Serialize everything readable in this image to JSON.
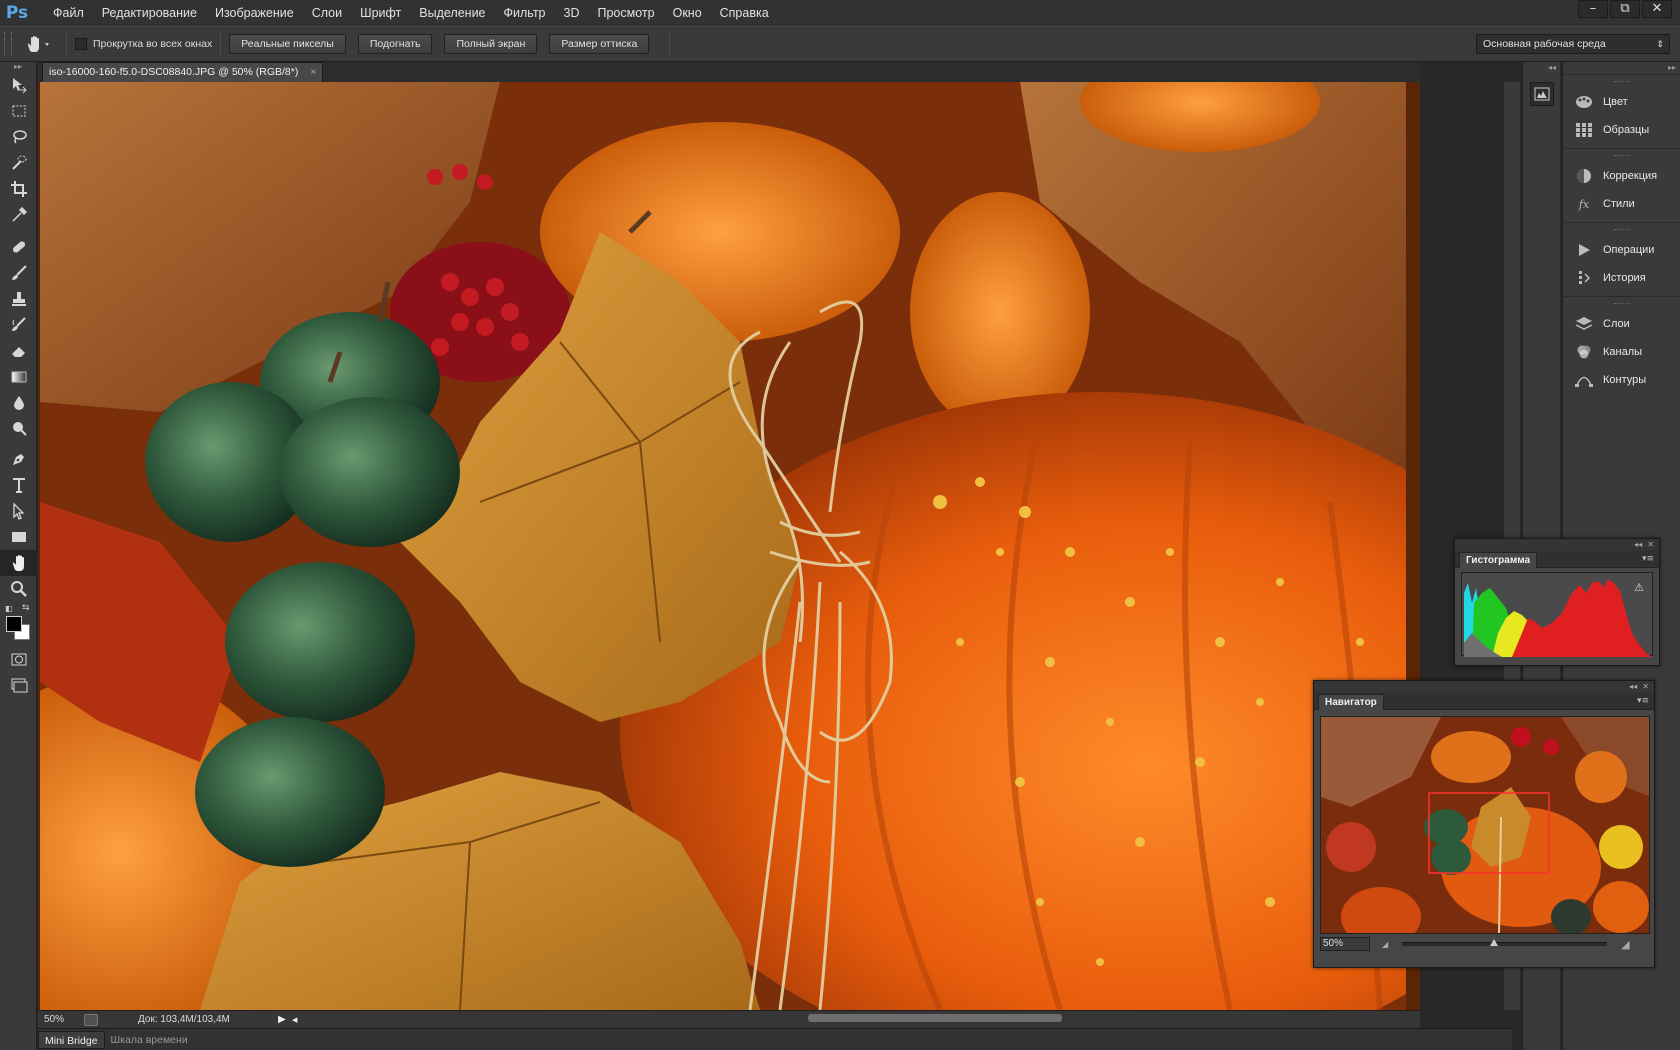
{
  "app": {
    "logo": "Ps"
  },
  "menu": [
    "Файл",
    "Редактирование",
    "Изображение",
    "Слои",
    "Шрифт",
    "Выделение",
    "Фильтр",
    "3D",
    "Просмотр",
    "Окно",
    "Справка"
  ],
  "window_controls": {
    "minimize": "–",
    "restore": "⧉",
    "close": "✕"
  },
  "options": {
    "scroll_all_windows": "Прокрутка во всех окнах",
    "buttons": [
      "Реальные пикселы",
      "Подогнать",
      "Полный экран",
      "Размер оттиска"
    ],
    "workspace": "Основная рабочая среда"
  },
  "document": {
    "tab_title": "iso-16000-160-f5.0-DSC08840.JPG @ 50% (RGB/8*)",
    "zoom": "50%",
    "doc_size": "Док: 103,4M/103,4M"
  },
  "bottom_tabs": [
    "Mini Bridge",
    "Шкала времени"
  ],
  "panels": [
    {
      "label": "Цвет",
      "icon": "palette-icon"
    },
    {
      "label": "Образцы",
      "icon": "swatches-grid-icon"
    },
    {
      "label": "Коррекция",
      "icon": "adjustment-circle-icon"
    },
    {
      "label": "Стили",
      "icon": "fx-styles-icon"
    },
    {
      "label": "Операции",
      "icon": "play-actions-icon"
    },
    {
      "label": "История",
      "icon": "history-icon"
    },
    {
      "label": "Слои",
      "icon": "layers-icon"
    },
    {
      "label": "Каналы",
      "icon": "channels-icon"
    },
    {
      "label": "Контуры",
      "icon": "paths-icon"
    }
  ],
  "histogram": {
    "title": "Гистограмма",
    "warning": "⚠"
  },
  "navigator": {
    "title": "Навигатор",
    "zoom": "50%",
    "zoom_level": 0.45
  },
  "colors": {
    "foreground": "#000000",
    "background": "#ffffff"
  }
}
